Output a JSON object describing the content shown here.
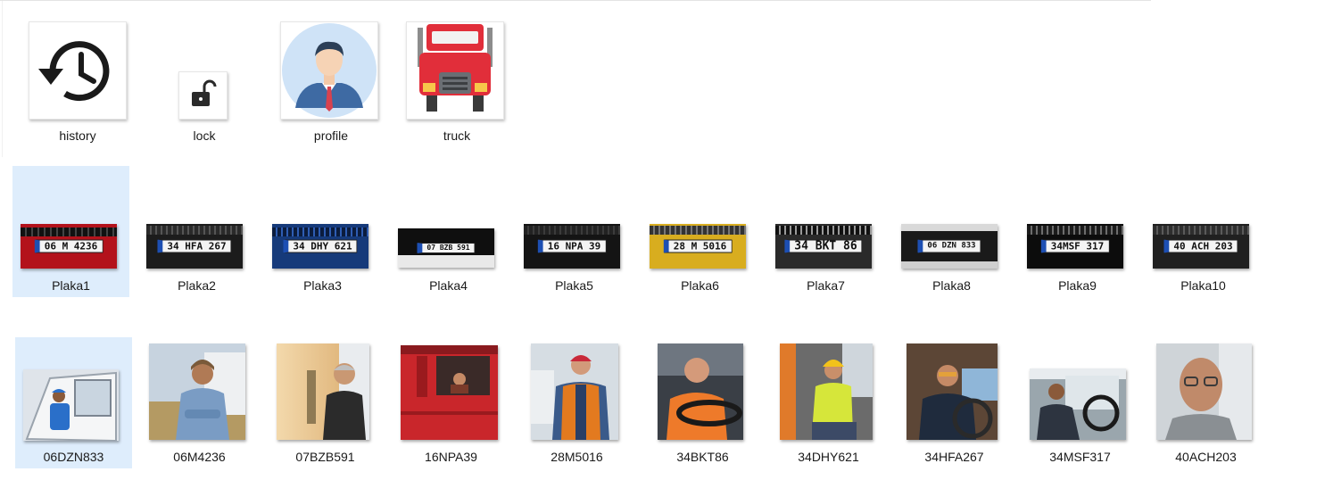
{
  "icons": [
    {
      "label": "history",
      "icon": "history-icon"
    },
    {
      "label": "lock",
      "icon": "lock-icon"
    },
    {
      "label": "profile",
      "icon": "profile-icon"
    },
    {
      "label": "truck",
      "icon": "truck-icon"
    }
  ],
  "plates": [
    {
      "label": "Plaka1",
      "plate_text": "06 M 4236",
      "bg": "#b3121b"
    },
    {
      "label": "Plaka2",
      "plate_text": "34 HFA 267",
      "bg": "#1c1c1c"
    },
    {
      "label": "Plaka3",
      "plate_text": "34 DHY 621",
      "bg": "#163a7a"
    },
    {
      "label": "Plaka4",
      "plate_text": "07 BZB 591",
      "bg": "#0f0f0f"
    },
    {
      "label": "Plaka5",
      "plate_text": "16 NPA 39",
      "bg": "#141414"
    },
    {
      "label": "Plaka6",
      "plate_text": "28 M 5016",
      "bg": "#d8ad1f"
    },
    {
      "label": "Plaka7",
      "plate_text": "34 BKT 86",
      "bg": "#2a2a2a"
    },
    {
      "label": "Plaka8",
      "plate_text": "06 DZN 833",
      "bg": "#1a1a1a"
    },
    {
      "label": "Plaka9",
      "plate_text": "34MSF 317",
      "bg": "#0c0c0c"
    },
    {
      "label": "Plaka10",
      "plate_text": "40 ACH 203",
      "bg": "#202020"
    }
  ],
  "drivers": [
    {
      "label": "06DZN833",
      "bg": "#dfe4ea",
      "accent": "#2a6fc9"
    },
    {
      "label": "06M4236",
      "bg": "#c7d3df",
      "accent": "#7a9cc4"
    },
    {
      "label": "07BZB591",
      "bg": "#e7c79a",
      "accent": "#2b2b2b"
    },
    {
      "label": "16NPA39",
      "bg": "#c9262b",
      "accent": "#7a3a2a"
    },
    {
      "label": "28M5016",
      "bg": "#d6dde3",
      "accent": "#e37a1f"
    },
    {
      "label": "34BKT86",
      "bg": "#3a3f46",
      "accent": "#ee7a2a"
    },
    {
      "label": "34DHY621",
      "bg": "#6b6b6b",
      "accent": "#d6e63a"
    },
    {
      "label": "34HFA267",
      "bg": "#5c4636",
      "accent": "#1f2b3d"
    },
    {
      "label": "34MSF317",
      "bg": "#9aa6ad",
      "accent": "#2d3440"
    },
    {
      "label": "40ACH203",
      "bg": "#cfd4d8",
      "accent": "#8a8f93"
    }
  ]
}
